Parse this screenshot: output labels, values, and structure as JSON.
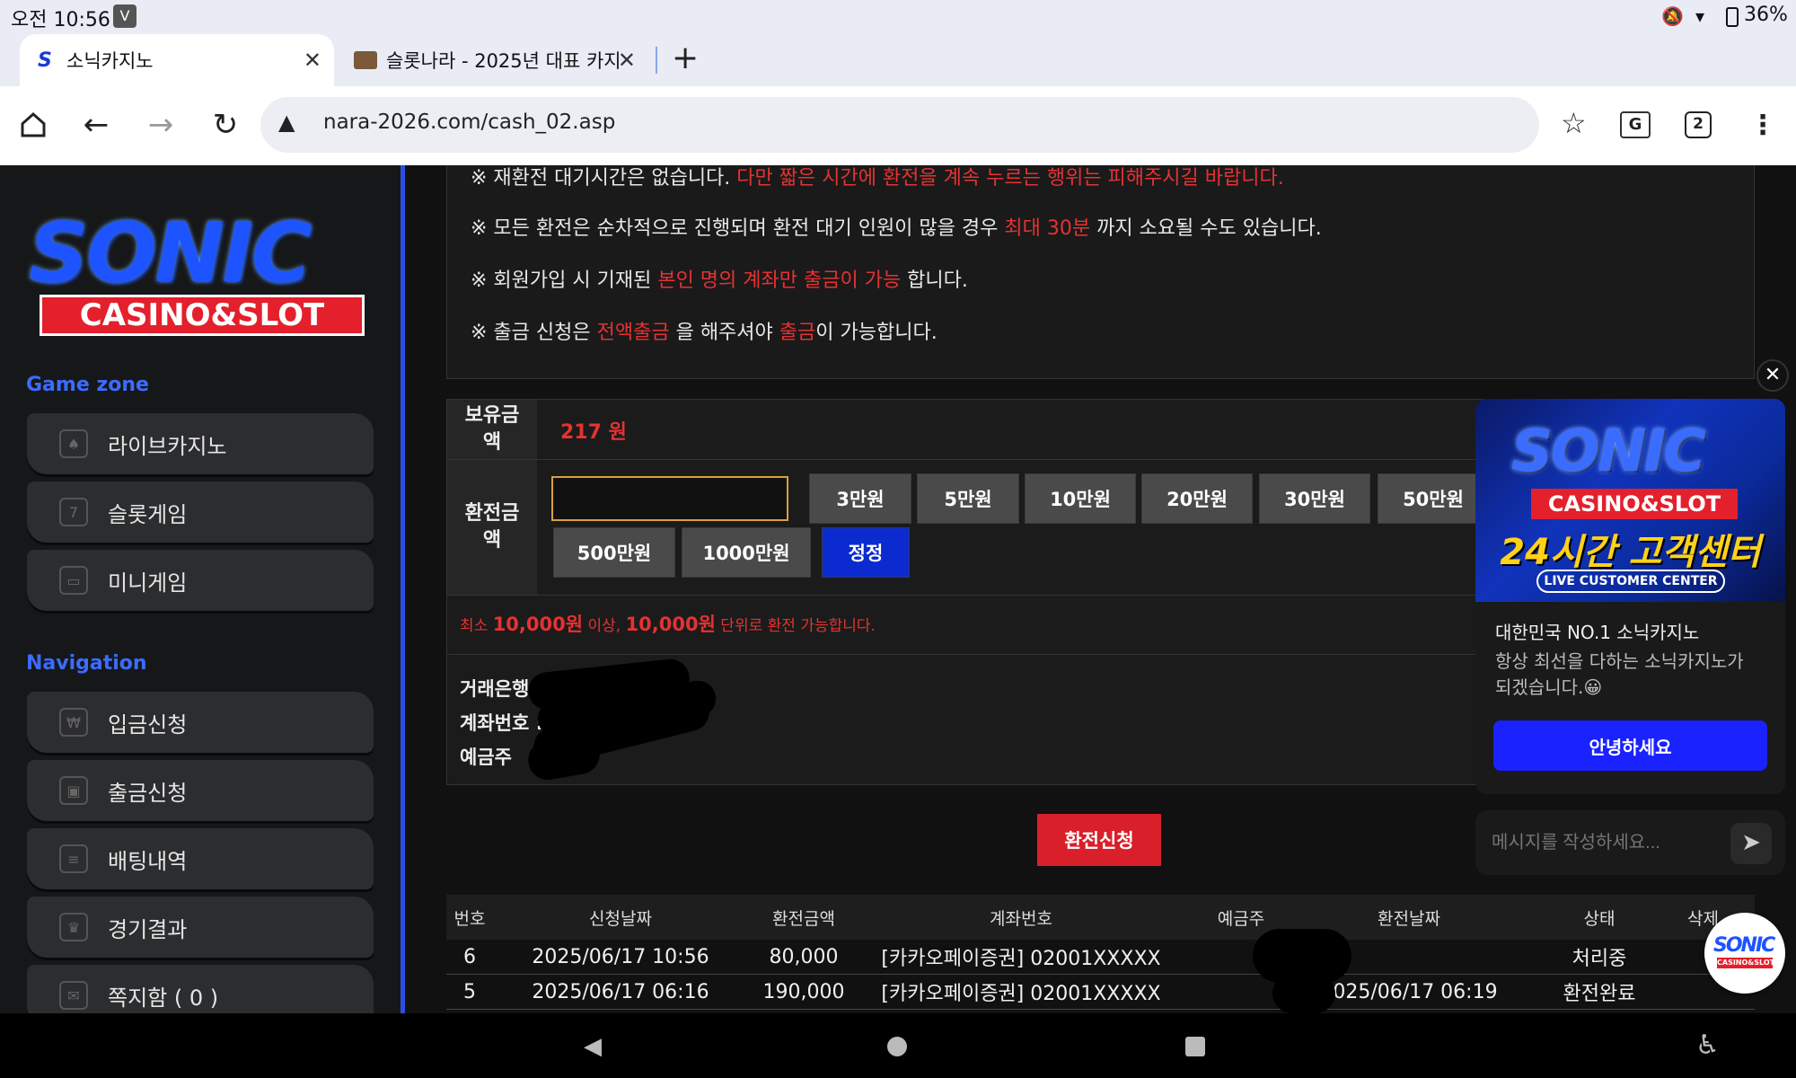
{
  "status": {
    "time": "오전 10:56",
    "battery": "36%"
  },
  "tabs": [
    {
      "title": "소닉카지노",
      "active": true
    },
    {
      "title": "슬롯나라 - 2025년 대표 카지노",
      "active": false
    }
  ],
  "browser": {
    "url": "nara-2026.com/cash_02.asp",
    "tab_count": "2"
  },
  "sidebar": {
    "logo_top": "SONIC",
    "logo_bottom": "CASINO&SLOT",
    "game_zone_title": "Game zone",
    "game_items": [
      "라이브카지노",
      "슬롯게임",
      "미니게임"
    ],
    "navigation_title": "Navigation",
    "nav_items": [
      "입금신청",
      "출금신청",
      "배팅내역",
      "경기결과",
      "쪽지함 ( 0 )"
    ]
  },
  "notice": {
    "line1_a": "※ 재환전 대기시간은 없습니다. ",
    "line1_b": "다만 짧은 시간에 환전을 계속 누르는 행위는 피해주시길 바랍니다.",
    "line2_a": "※ 모든 환전은 순차적으로 진행되며 환전 대기 인원이 많을 경우 ",
    "line2_b": "최대 30분",
    "line2_c": " 까지 소요될 수도 있습니다.",
    "line3_a": "※ 회원가입 시 기재된 ",
    "line3_b": "본인 명의 계좌만 출금이 가능",
    "line3_c": " 합니다.",
    "line4_a": "※ 출금 신청은 ",
    "line4_b": "전액출금",
    "line4_c": " 을 해주셔야 ",
    "line4_d": "출금",
    "line4_e": "이 가능합니다."
  },
  "form": {
    "balance_label": "보유금액",
    "balance_value": "217 원",
    "amount_label": "환전금액",
    "amount_input_value": "",
    "amount_buttons_row1": [
      "3만원",
      "5만원",
      "10만원",
      "20만원",
      "30만원",
      "50만원"
    ],
    "amount_buttons_row2": [
      "500만원",
      "1000만원"
    ],
    "reset_button": "정정",
    "rule_a": "최소 ",
    "rule_b": "10,000원",
    "rule_c": " 이상, ",
    "rule_d": "10,000원",
    "rule_e": "  단위로 환전 가능합니다.",
    "bank_label": "거래은행",
    "account_label": "계좌번호 :",
    "holder_label": "예금주",
    "submit": "환전신청"
  },
  "table": {
    "headers": [
      "번호",
      "신청날짜",
      "환전금액",
      "계좌번호",
      "예금주",
      "환전날짜",
      "상태",
      "삭제"
    ],
    "rows": [
      {
        "no": "6",
        "date": "2025/06/17 10:56",
        "amount": "80,000",
        "account": "[카카오페이증권] 02001XXXXX",
        "holder": "",
        "done_date": "",
        "status": "처리중"
      },
      {
        "no": "5",
        "date": "2025/06/17 06:16",
        "amount": "190,000",
        "account": "[카카오페이증권] 02001XXXXX",
        "holder": "",
        "done_date": "2025/06/17 06:19",
        "status": "환전완료"
      }
    ]
  },
  "chat": {
    "banner_top": "SONIC",
    "banner_mid": "CASINO&SLOT",
    "banner_big": "24시간 고객센터",
    "banner_small": "LIVE CUSTOMER CENTER",
    "title": "대한민국 NO.1 소닉카지노",
    "body": "항상 최선을 다하는 소닉카지노가 되겠습니다.😀",
    "button": "안녕하세요",
    "input_placeholder": "메시지를 작성하세요..."
  },
  "floating_logo": {
    "top": "SONIC",
    "bottom": "CASINO&SLOT"
  },
  "colors": {
    "accent_blue": "#1a22ff",
    "red": "#d91f2a",
    "nav_title": "#3b6cff"
  }
}
